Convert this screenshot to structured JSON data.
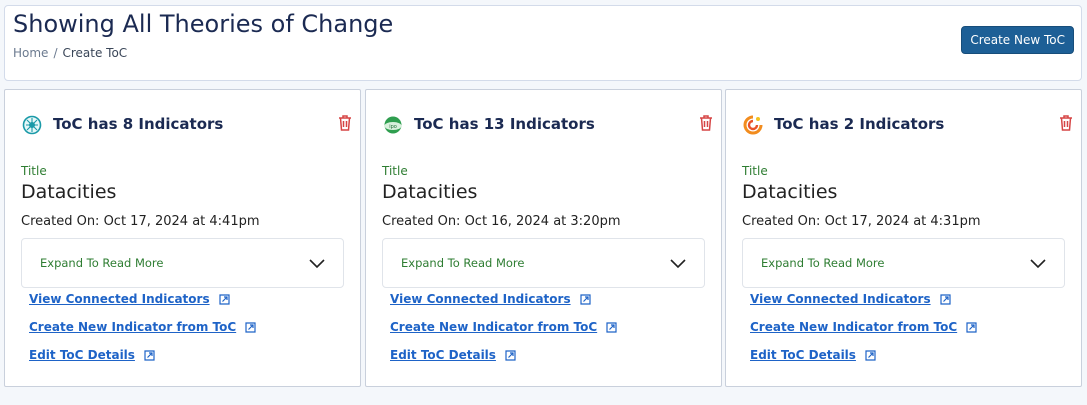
{
  "header": {
    "title": "Showing All Theories of Change",
    "breadcrumb": {
      "home": "Home",
      "separator": "/",
      "current": "Create ToC"
    },
    "create_button": "Create New ToC"
  },
  "colors": {
    "accent": "#1d5f96",
    "title": "#1b2a52",
    "label_green": "#2e7d32",
    "link": "#1e63c7",
    "trash": "#d64545"
  },
  "cards": [
    {
      "logo_icon": "teal-network-logo-icon",
      "heading": "ToC has 8 Indicators",
      "title_label": "Title",
      "title_value": "Datacities",
      "created": "Created On: Oct 17, 2024 at 4:41pm",
      "expand_label": "Expand To Read More",
      "links": [
        "View Connected Indicators",
        "Create New Indicator from ToC",
        "Edit ToC Details"
      ]
    },
    {
      "logo_icon": "green-globe-logo-icon",
      "heading": "ToC has 13 Indicators",
      "title_label": "Title",
      "title_value": "Datacities",
      "created": "Created On: Oct 16, 2024 at 3:20pm",
      "expand_label": "Expand To Read More",
      "links": [
        "View Connected Indicators",
        "Create New Indicator from ToC",
        "Edit ToC Details"
      ]
    },
    {
      "logo_icon": "orange-swirl-logo-icon",
      "heading": "ToC has 2 Indicators",
      "title_label": "Title",
      "title_value": "Datacities",
      "created": "Created On: Oct 17, 2024 at 4:31pm",
      "expand_label": "Expand To Read More",
      "links": [
        "View Connected Indicators",
        "Create New Indicator from ToC",
        "Edit ToC Details"
      ]
    }
  ]
}
